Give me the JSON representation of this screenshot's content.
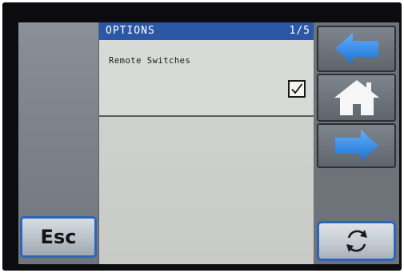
{
  "header": {
    "title": "OPTIONS",
    "page_indicator": "1/5"
  },
  "options": [
    {
      "label": "Remote Switches",
      "checked": true
    }
  ],
  "buttons": {
    "esc_label": "Esc"
  },
  "icons": {
    "back": "arrow-left-icon",
    "home": "home-icon",
    "forward": "arrow-right-icon",
    "refresh": "refresh-icon",
    "check": "checkmark-icon"
  },
  "colors": {
    "title_bar": "#2c57a6",
    "arrow_blue": "#2f86e0",
    "button_border": "#2d66b8",
    "panel": "#d3d5d2"
  }
}
